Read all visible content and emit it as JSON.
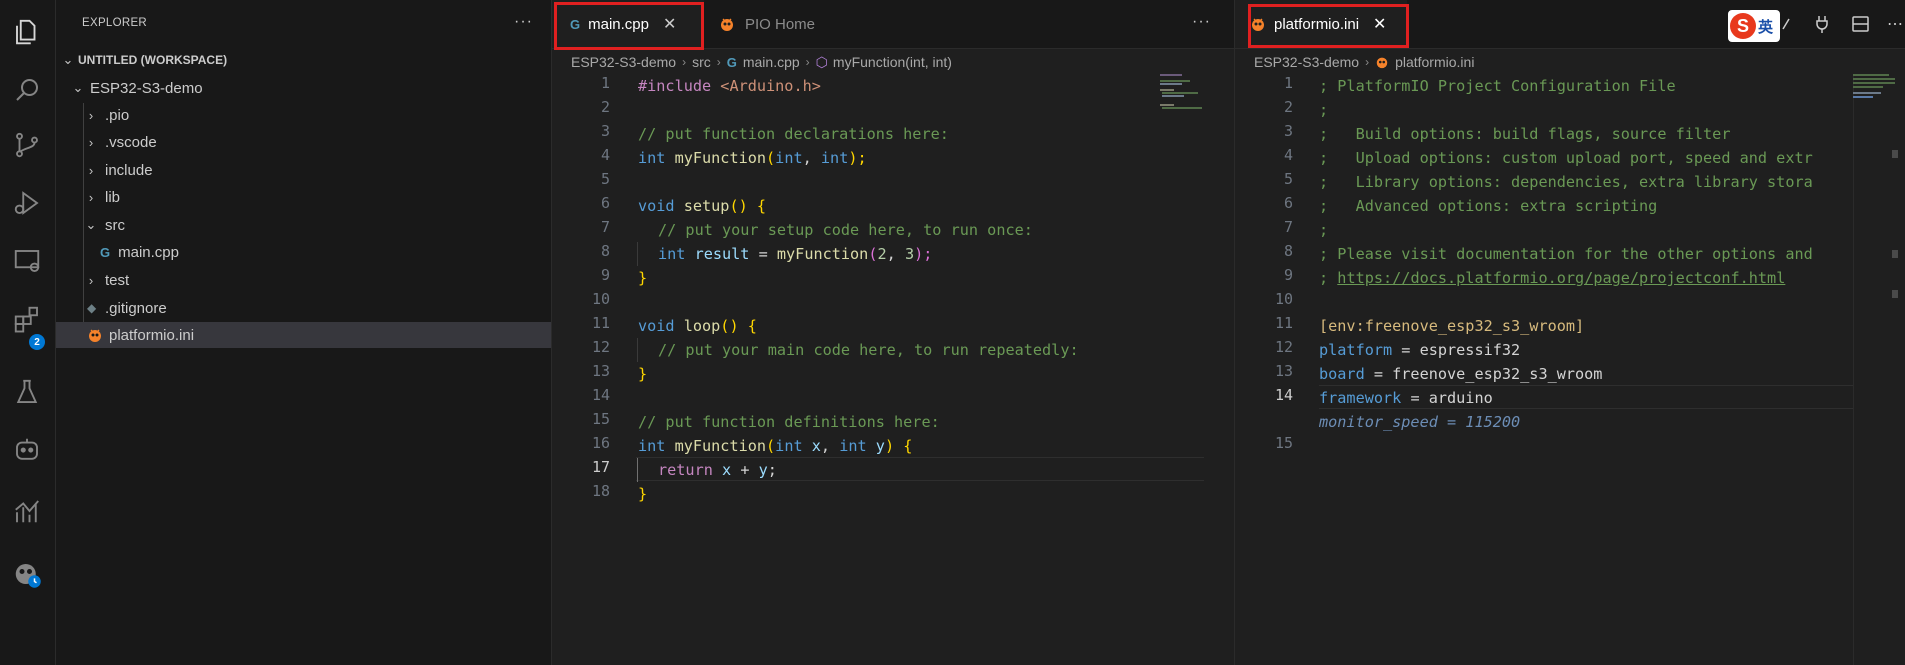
{
  "activity_bar": {
    "icons": [
      "explorer-icon",
      "search-icon",
      "source-control-icon",
      "run-debug-icon",
      "remote-explorer-icon",
      "extensions-icon",
      "testing-icon",
      "copilot-icon",
      "charts-icon",
      "platformio-icon"
    ],
    "extensions_badge": "2"
  },
  "sidebar": {
    "title": "EXPLORER",
    "more": "···",
    "workspace": "UNTITLED (WORKSPACE)",
    "project": "ESP32-S3-demo",
    "items": [
      {
        "label": ".pio"
      },
      {
        "label": ".vscode"
      },
      {
        "label": "include"
      },
      {
        "label": "lib"
      },
      {
        "label": "src"
      },
      {
        "label": "main.cpp"
      },
      {
        "label": "test"
      },
      {
        "label": ".gitignore"
      },
      {
        "label": "platformio.ini"
      }
    ]
  },
  "editor_left": {
    "tabs": [
      {
        "label": "main.cpp",
        "close": "✕"
      },
      {
        "label": "PIO Home"
      }
    ],
    "more": "···",
    "breadcrumb": [
      "ESP32-S3-demo",
      "src",
      "main.cpp",
      "myFunction(int, int)"
    ],
    "line_numbers": [
      "1",
      "2",
      "3",
      "4",
      "5",
      "6",
      "7",
      "8",
      "9",
      "10",
      "11",
      "12",
      "13",
      "14",
      "15",
      "16",
      "17",
      "18"
    ],
    "current_line": "17",
    "code": {
      "l1a": "#include ",
      "l1b": "<Arduino.h>",
      "l3": "// put function declarations here:",
      "l4a": "int ",
      "l4b": "myFunction",
      "l4c": "(",
      "l4d": "int",
      "l4e": ", ",
      "l4f": "int",
      "l4g": ");",
      "l6a": "void ",
      "l6b": "setup",
      "l6c": "() {",
      "l7": "// put your setup code here, to run once:",
      "l8a": "int ",
      "l8b": "result",
      "l8c": " = ",
      "l8d": "myFunction",
      "l8e": "(",
      "l8f": "2",
      "l8g": ", ",
      "l8h": "3",
      "l8i": ");",
      "l9": "}",
      "l11a": "void ",
      "l11b": "loop",
      "l11c": "() {",
      "l12": "// put your main code here, to run repeatedly:",
      "l13": "}",
      "l15": "// put function definitions here:",
      "l16a": "int ",
      "l16b": "myFunction",
      "l16c": "(",
      "l16d": "int ",
      "l16e": "x",
      "l16f": ", ",
      "l16g": "int ",
      "l16h": "y",
      "l16i": ") {",
      "l17a": "return ",
      "l17b": "x",
      "l17c": " + ",
      "l17d": "y",
      "l17e": ";",
      "l18": "}"
    }
  },
  "editor_right": {
    "tab": {
      "label": "platformio.ini",
      "close": "✕"
    },
    "ime": {
      "logo": "S",
      "label": "英"
    },
    "breadcrumb": [
      "ESP32-S3-demo",
      "platformio.ini"
    ],
    "line_numbers": [
      "1",
      "2",
      "3",
      "4",
      "5",
      "6",
      "7",
      "8",
      "9",
      "10",
      "11",
      "12",
      "13",
      "14",
      "15"
    ],
    "current_line": "14",
    "code": {
      "l1": "; PlatformIO Project Configuration File",
      "l2": ";",
      "l3": ";   Build options: build flags, source filter",
      "l4": ";   Upload options: custom upload port, speed and extr",
      "l5": ";   Library options: dependencies, extra library stora",
      "l6": ";   Advanced options: extra scripting",
      "l7": ";",
      "l8": "; Please visit documentation for the other options and",
      "l9a": "; ",
      "l9b": "https://docs.platformio.org/page/projectconf.html",
      "l11": "[env:freenove_esp32_s3_wroom]",
      "l12a": "platform",
      "l12b": " = espressif32",
      "l13a": "board",
      "l13b": " = freenove_esp32_s3_wroom",
      "l14a": "framework",
      "l14b": " = arduino",
      "ghost": "monitor_speed = 115200"
    }
  }
}
